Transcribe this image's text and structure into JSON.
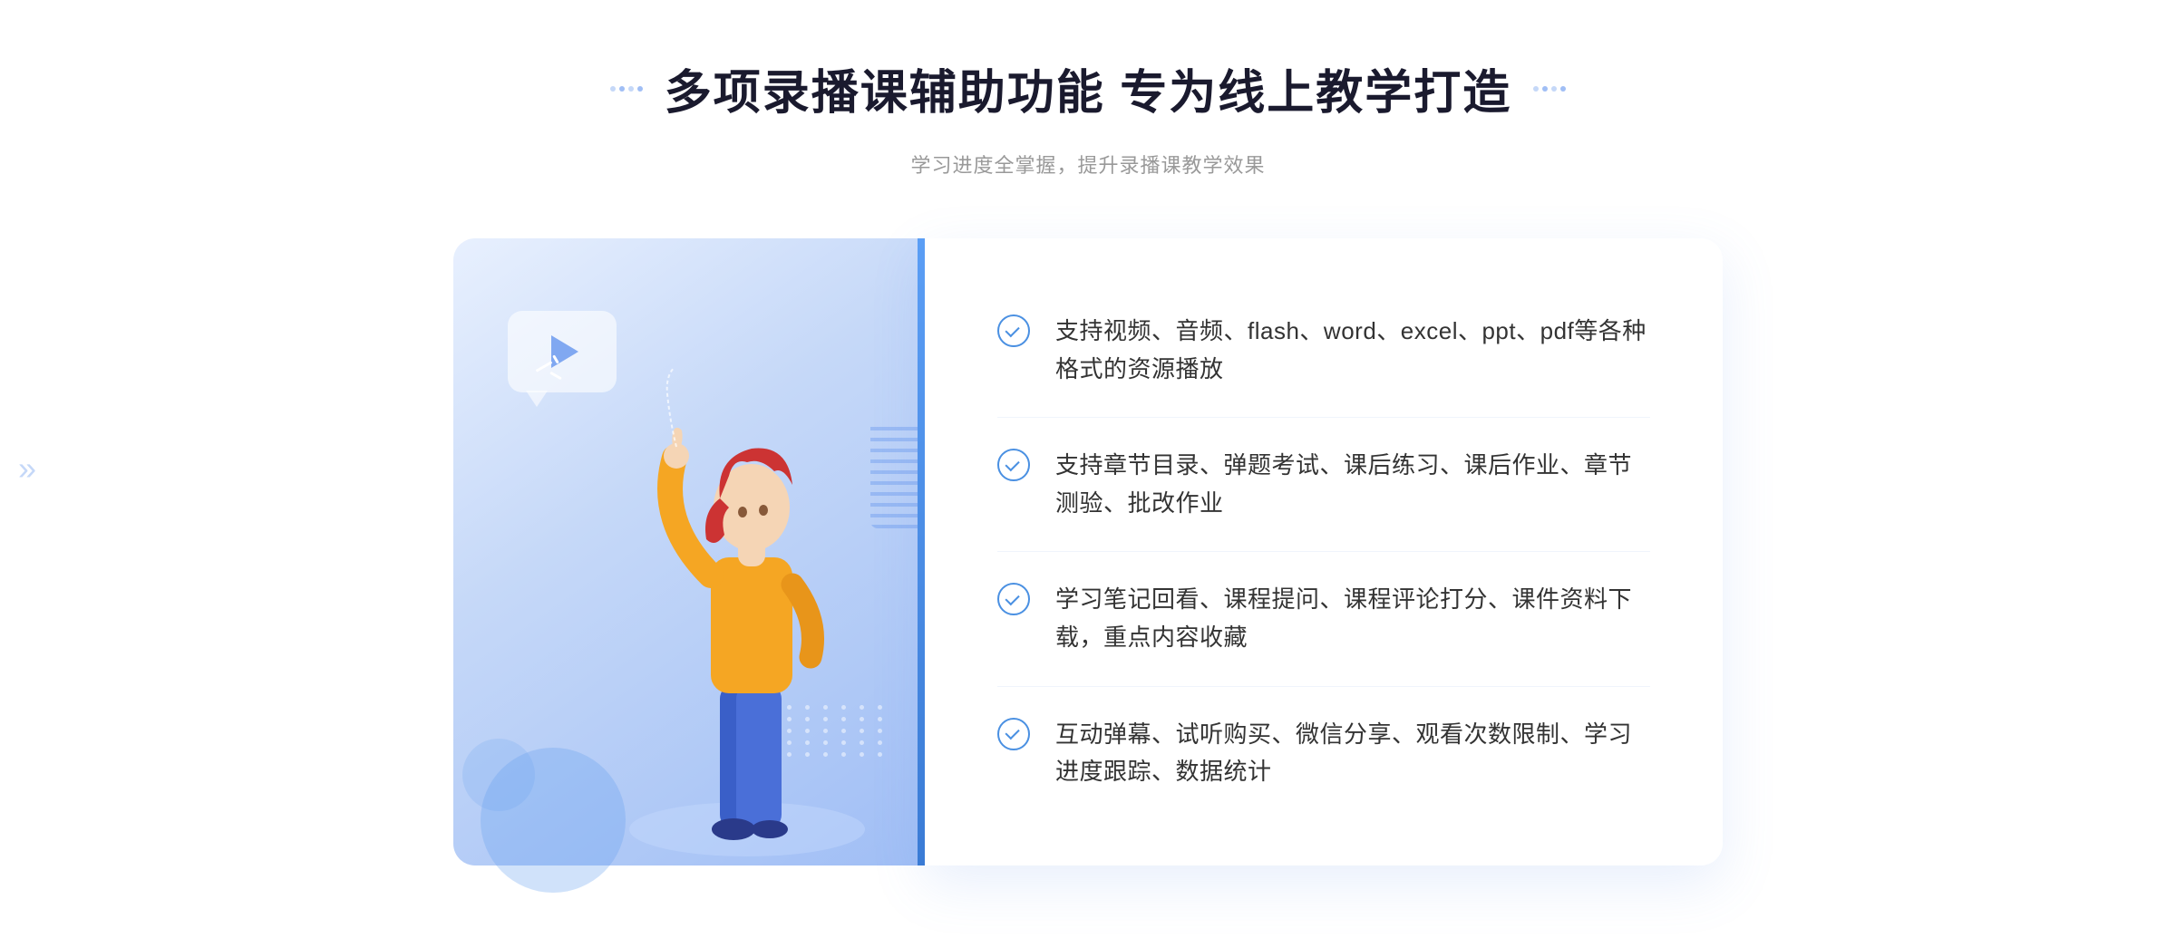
{
  "header": {
    "title": "多项录播课辅助功能 专为线上教学打造",
    "subtitle": "学习进度全掌握，提升录播课教学效果",
    "dots_left": [
      "dot",
      "dot",
      "dot",
      "dot",
      "dot",
      "dot"
    ],
    "dots_right": [
      "dot",
      "dot",
      "dot",
      "dot",
      "dot",
      "dot"
    ]
  },
  "features": [
    {
      "id": 1,
      "text": "支持视频、音频、flash、word、excel、ppt、pdf等各种格式的资源播放"
    },
    {
      "id": 2,
      "text": "支持章节目录、弹题考试、课后练习、课后作业、章节测验、批改作业"
    },
    {
      "id": 3,
      "text": "学习笔记回看、课程提问、课程评论打分、课件资料下载，重点内容收藏"
    },
    {
      "id": 4,
      "text": "互动弹幕、试听购买、微信分享、观看次数限制、学习进度跟踪、数据统计"
    }
  ],
  "side_arrows": {
    "label": "»"
  },
  "colors": {
    "accent_blue": "#4a90e2",
    "light_blue": "#c5d8f8",
    "gradient_start": "#e8f0fe",
    "gradient_end": "#a0bef5"
  }
}
